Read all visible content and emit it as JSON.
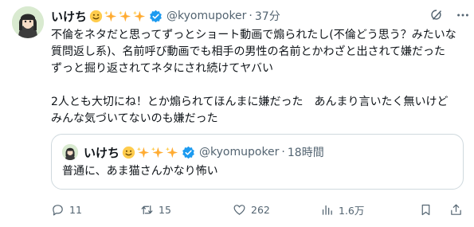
{
  "tweet": {
    "author": {
      "name": "いけち",
      "handle": "@kyomupoker",
      "dot": "·",
      "time": "37分"
    },
    "text": "不倫をネタだと思ってずっとショート動画で煽られたし(不倫どう思う？みたいな質問返し系)、名前呼び動画でも相手の男性の名前とかわざと出されて嫌だった　ずっと掘り返されてネタにされ続けてヤバい\n\n2人とも大切にね！とか煽られてほんまに嫌だった　あんまり言いたく無いけど　みんな気づいてないのも嫌だった",
    "quote": {
      "name": "いけち",
      "handle": "@kyomupoker",
      "dot": "·",
      "time": "18時間",
      "text": "普通に、あま猫さんかなり怖い"
    },
    "actions": {
      "replies": "11",
      "retweets": "15",
      "likes": "262",
      "views": "1.6万"
    }
  },
  "colors": {
    "text": "#0f1419",
    "secondary": "#536471",
    "verified": "#1d9bf0",
    "border": "#cfd9de"
  },
  "icons": [
    "avatar",
    "grinning-emoji-icon",
    "sparkles-icon",
    "verified-badge-icon",
    "grok-icon",
    "more-icon",
    "reply-icon",
    "retweet-icon",
    "like-icon",
    "views-icon",
    "bookmark-icon",
    "share-icon"
  ]
}
